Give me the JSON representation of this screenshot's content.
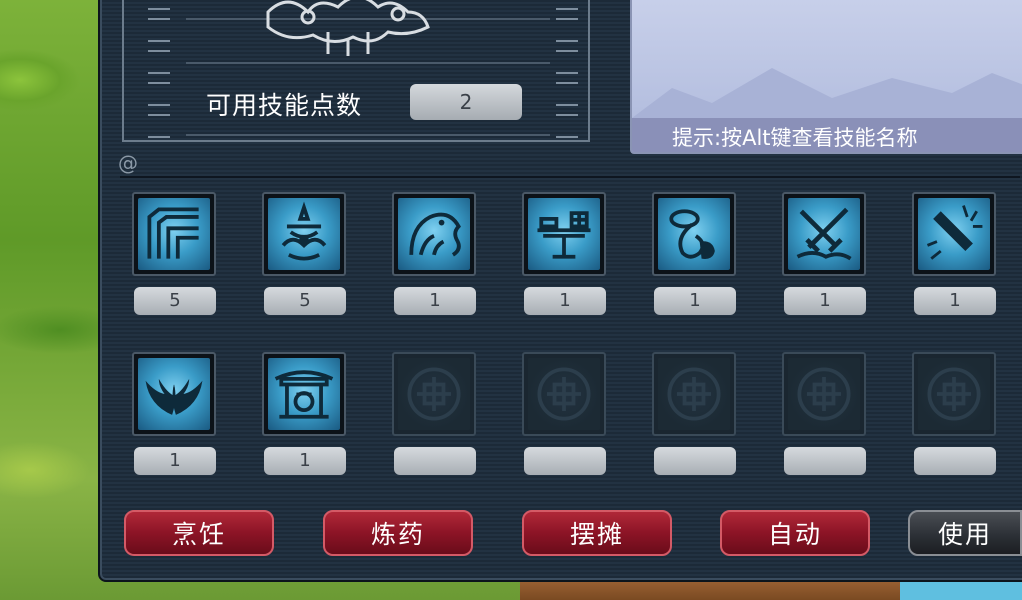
{
  "skill_points": {
    "label": "可用技能点数",
    "value": "2"
  },
  "hint": {
    "text": "提示:按Alt键查看技能名称"
  },
  "skills_row1": [
    {
      "icon": "maze-icon",
      "level": "5"
    },
    {
      "icon": "flame-lotus-icon",
      "level": "5"
    },
    {
      "icon": "beast-rune-icon",
      "level": "1"
    },
    {
      "icon": "altar-icon",
      "level": "1"
    },
    {
      "icon": "gourd-icon",
      "level": "1"
    },
    {
      "icon": "crossed-swords-icon",
      "level": "1"
    },
    {
      "icon": "sword-burst-icon",
      "level": "1"
    }
  ],
  "skills_row2": [
    {
      "icon": "wings-icon",
      "level": "1"
    },
    {
      "icon": "pavilion-icon",
      "level": "1"
    },
    {
      "icon": "empty-slot-icon",
      "level": ""
    },
    {
      "icon": "empty-slot-icon",
      "level": ""
    },
    {
      "icon": "empty-slot-icon",
      "level": ""
    },
    {
      "icon": "empty-slot-icon",
      "level": ""
    },
    {
      "icon": "empty-slot-icon",
      "level": ""
    }
  ],
  "buttons": {
    "cook": "烹饪",
    "alchemy": "炼药",
    "stall": "摆摊",
    "auto": "自动",
    "use": "使用"
  }
}
